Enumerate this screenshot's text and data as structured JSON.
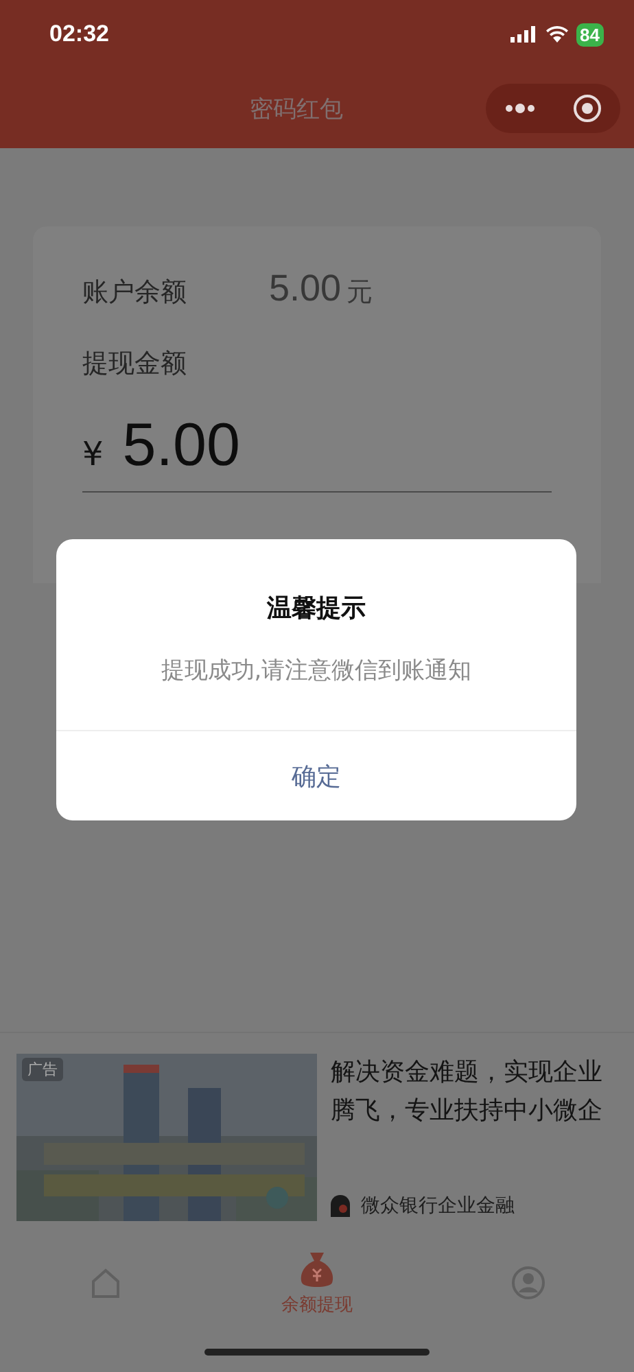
{
  "status_bar": {
    "time": "02:32",
    "battery": "84"
  },
  "nav": {
    "title": "密码红包"
  },
  "balance": {
    "label": "账户余额",
    "amount": "5.00",
    "unit": "元"
  },
  "withdraw": {
    "label": "提现金额",
    "currency": "¥",
    "value": "5.00"
  },
  "dialog": {
    "title": "温馨提示",
    "message": "提现成功,请注意微信到账通知",
    "button": "确定"
  },
  "ad": {
    "badge": "广告",
    "headline": "解决资金难题，实现企业腾飞，专业扶持中小微企",
    "advertiser": "微众银行企业金融"
  },
  "tab_bar": [
    {
      "kind": "home",
      "selected": false
    },
    {
      "kind": "wallet",
      "label": "余额提现",
      "selected": true
    },
    {
      "kind": "profile",
      "selected": false
    }
  ]
}
